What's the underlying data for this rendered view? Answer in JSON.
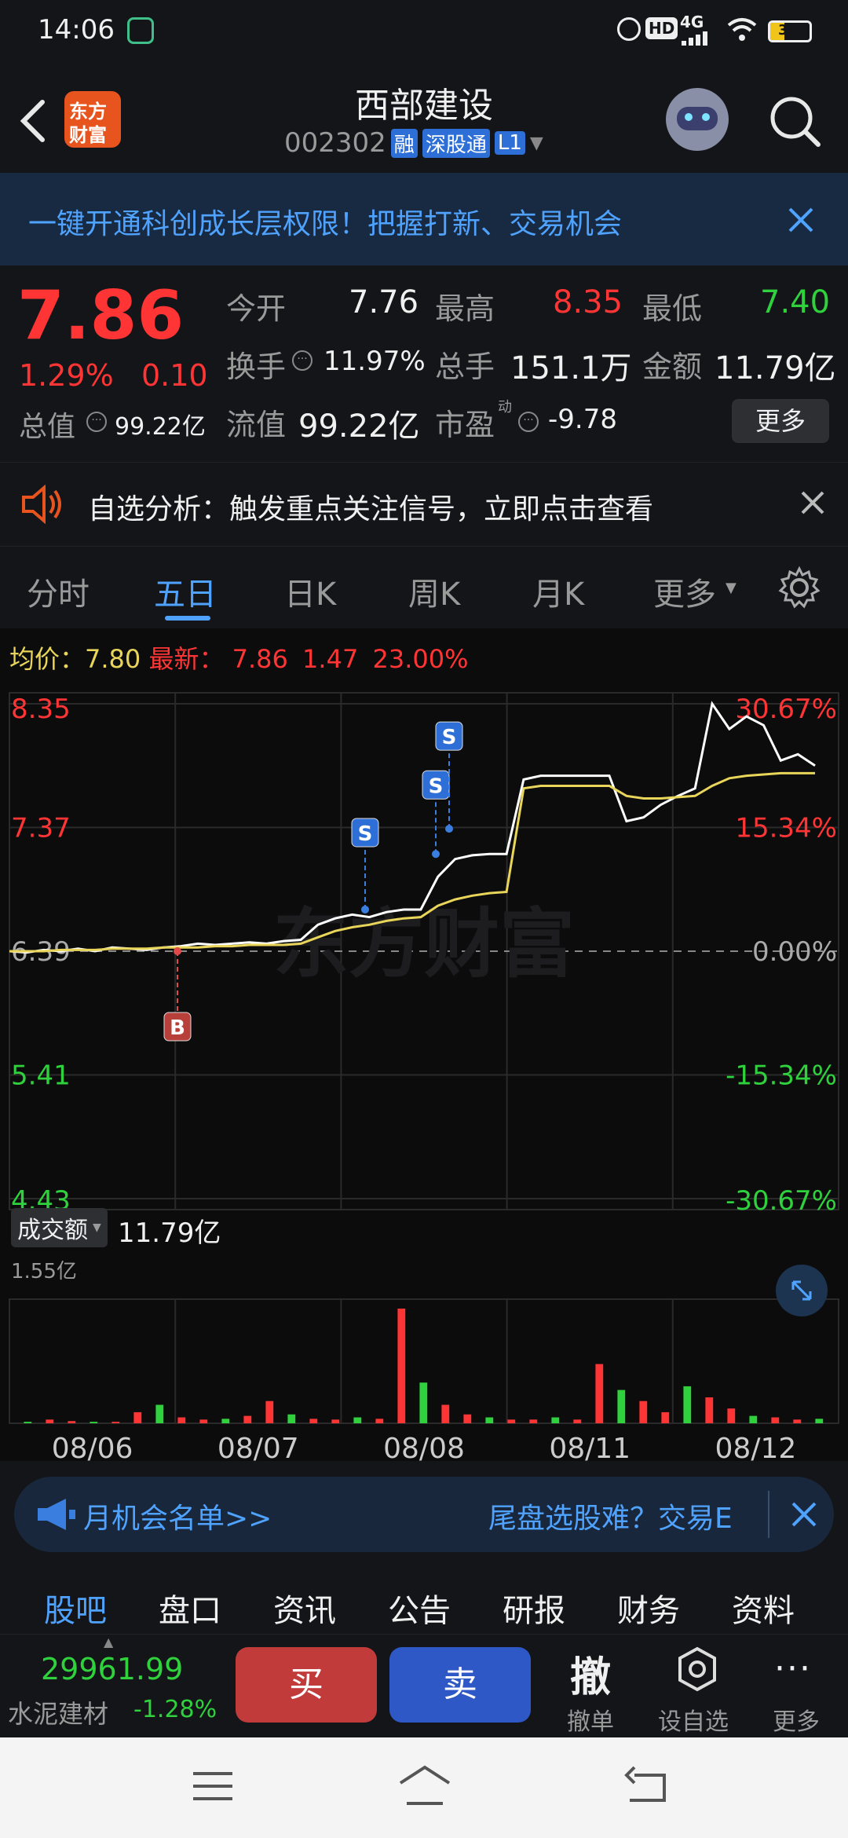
{
  "status": {
    "time": "14:06",
    "network": "4G",
    "battery": "34"
  },
  "header": {
    "logo_line1": "东方",
    "logo_line2": "财富",
    "stock_name": "西部建设",
    "stock_code": "002302",
    "badge_rong": "融",
    "badge_sgt": "深股通",
    "badge_level": "L1"
  },
  "promo": {
    "text": "一键开通科创成长层权限！把握打新、交易机会"
  },
  "quote": {
    "price": "7.86",
    "change_pct": "1.29%",
    "change_abs": "0.10",
    "today_open_label": "今开",
    "today_open": "7.76",
    "high_label": "最高",
    "high": "8.35",
    "low_label": "最低",
    "low": "7.40",
    "turnover_label": "换手",
    "turnover": "11.97%",
    "volume_label": "总手",
    "volume": "151.1万",
    "amount_label": "金额",
    "amount": "11.79亿",
    "total_value_label": "总值",
    "total_value": "99.22亿",
    "float_value_label": "流值",
    "float_value": "99.22亿",
    "pe_label": "市盈",
    "pe_sup": "动",
    "pe": "-9.78",
    "more_button": "更多"
  },
  "alert": {
    "text": "自选分析：触发重点关注信号，立即点击查看"
  },
  "chart_tabs": {
    "items": [
      "分时",
      "五日",
      "日K",
      "周K",
      "月K",
      "更多"
    ],
    "active_index": 1
  },
  "chart_header": {
    "avg_label": "均价：7.80",
    "latest_label": "最新：",
    "latest_price": "7.86",
    "latest_change": "1.47",
    "latest_pct": "23.00%"
  },
  "chart_data": {
    "type": "line",
    "title": "",
    "x_labels": [
      "08/06",
      "08/07",
      "08/08",
      "08/11",
      "08/12"
    ],
    "y_ticks_left": [
      "8.35",
      "7.37",
      "6.39",
      "5.41",
      "4.43"
    ],
    "y_ticks_right": [
      "30.67%",
      "15.34%",
      "0.00%",
      "-15.34%",
      "-30.67%"
    ],
    "ylim": [
      4.43,
      8.35
    ],
    "baseline": 6.39,
    "series": [
      {
        "name": "",
        "color": "#ffffff",
        "values": [
          6.39,
          6.38,
          6.4,
          6.39,
          6.41,
          6.39,
          6.42,
          6.41,
          6.4,
          6.42,
          6.43,
          6.45,
          6.44,
          6.45,
          6.46,
          6.45,
          6.47,
          6.48,
          6.6,
          6.65,
          6.68,
          6.66,
          6.7,
          6.72,
          6.72,
          6.98,
          7.12,
          7.15,
          7.16,
          7.16,
          7.75,
          7.78,
          7.78,
          7.78,
          7.78,
          7.78,
          7.42,
          7.45,
          7.55,
          7.62,
          7.68,
          8.35,
          8.15,
          8.25,
          8.18,
          7.9,
          7.95,
          7.86
        ]
      },
      {
        "name": "",
        "color": "#e8d55a",
        "values": [
          6.39,
          6.39,
          6.39,
          6.4,
          6.4,
          6.4,
          6.41,
          6.41,
          6.41,
          6.42,
          6.42,
          6.42,
          6.43,
          6.43,
          6.44,
          6.44,
          6.44,
          6.45,
          6.5,
          6.55,
          6.58,
          6.6,
          6.63,
          6.65,
          6.66,
          6.75,
          6.8,
          6.83,
          6.85,
          6.86,
          7.68,
          7.7,
          7.7,
          7.7,
          7.7,
          7.7,
          7.62,
          7.6,
          7.6,
          7.61,
          7.62,
          7.7,
          7.76,
          7.78,
          7.79,
          7.8,
          7.8,
          7.8
        ]
      }
    ],
    "trade_markers": [
      "B",
      "S",
      "S",
      "S"
    ]
  },
  "volume_panel": {
    "label": "成交额",
    "total": "11.79亿",
    "max_label": "1.55亿",
    "chart_data": {
      "type": "bar",
      "values": [
        0.02,
        0.05,
        0.03,
        0.02,
        0.02,
        0.15,
        0.25,
        0.08,
        0.05,
        0.06,
        0.1,
        0.3,
        0.12,
        0.06,
        0.05,
        0.08,
        0.06,
        1.55,
        0.55,
        0.25,
        0.12,
        0.08,
        0.05,
        0.05,
        0.08,
        0.05,
        0.8,
        0.45,
        0.3,
        0.15,
        0.5,
        0.35,
        0.2,
        0.1,
        0.08,
        0.05,
        0.06
      ],
      "ylim": [
        0,
        1.55
      ]
    }
  },
  "banner": {
    "left_text": "月机会名单>>",
    "right_text": "尾盘选股难？交易E"
  },
  "bottom_tabs": {
    "items": [
      "股吧",
      "盘口",
      "资讯",
      "公告",
      "研报",
      "财务",
      "资料"
    ],
    "active_index": 0
  },
  "toolbar": {
    "index_value": "29961.99",
    "index_name": "水泥建材",
    "index_change": "-1.28%",
    "buy": "买",
    "sell": "卖",
    "cancel_glyph": "撤",
    "cancel_label": "撤单",
    "watch_label": "设自选",
    "more_label": "更多"
  },
  "watermark": "东方财富"
}
